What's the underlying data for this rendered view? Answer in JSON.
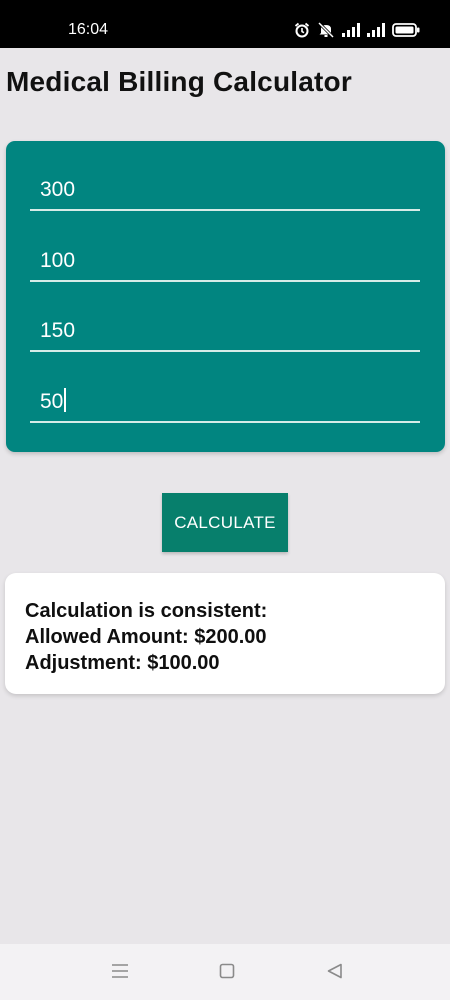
{
  "status_bar": {
    "time": "16:04",
    "icons": [
      "alarm-icon",
      "mute-icon",
      "signal-icon",
      "signal-icon",
      "battery-icon"
    ]
  },
  "header": {
    "title": "Medical Billing Calculator"
  },
  "form": {
    "fields": [
      {
        "value": "300"
      },
      {
        "value": "100"
      },
      {
        "value": "150"
      },
      {
        "value": "50"
      }
    ],
    "card_color": "#018580"
  },
  "actions": {
    "calculate_label": "CALCULATE",
    "button_color": "#077f6c"
  },
  "result": {
    "line1": "Calculation is consistent:",
    "line2": "Allowed Amount: $200.00",
    "line3": "Adjustment: $100.00"
  },
  "nav_bar": {
    "buttons": [
      "menu-icon",
      "home-icon",
      "back-icon"
    ]
  }
}
